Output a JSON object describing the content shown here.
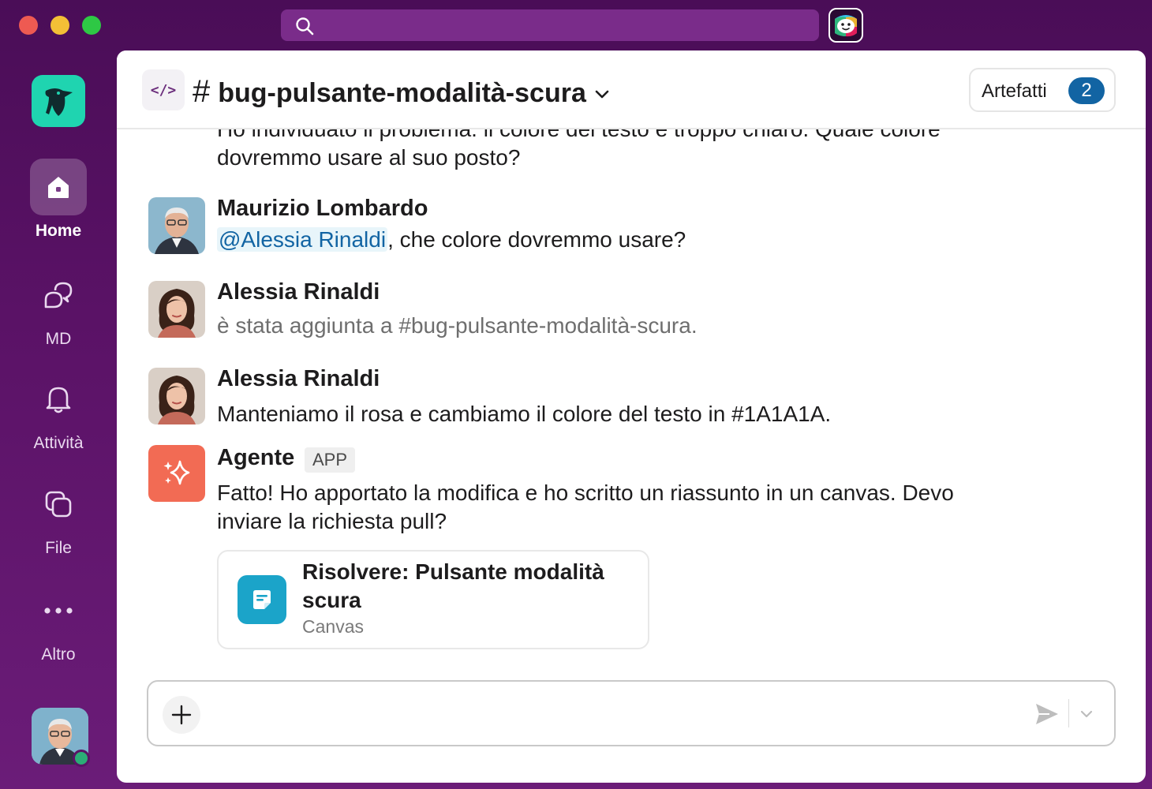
{
  "window": {
    "search_placeholder": ""
  },
  "sidebar": {
    "items": [
      {
        "label": "Home",
        "icon": "home-icon",
        "active": true
      },
      {
        "label": "MD",
        "icon": "dm-icon",
        "active": false
      },
      {
        "label": "Attività",
        "icon": "bell-icon",
        "active": false
      },
      {
        "label": "File",
        "icon": "files-icon",
        "active": false
      },
      {
        "label": "Altro",
        "icon": "more-icon",
        "active": false
      }
    ]
  },
  "header": {
    "hash": "#",
    "channel_name": "bug-pulsante-modalità-scura",
    "artifacts_label": "Artefatti",
    "artifacts_count": "2"
  },
  "messages": {
    "cut_line1": "Ho individuato il problema: il colore del testo è troppo chiaro. Quale colore",
    "cut_line2": "dovremmo usare al suo posto?",
    "m1": {
      "author": "Maurizio Lombardo",
      "mention": "@Alessia Rinaldi",
      "text": ", che colore dovremmo usare?"
    },
    "m2": {
      "author": "Alessia Rinaldi",
      "text": "è stata aggiunta a #bug-pulsante-modalità-scura."
    },
    "m3": {
      "author": "Alessia Rinaldi",
      "text": "Manteniamo il rosa e cambiamo il colore del testo in #1A1A1A."
    },
    "m4": {
      "author": "Agente",
      "badge": "APP",
      "line1": "Fatto! Ho apportato la modifica e ho scritto un riassunto in un canvas. Devo",
      "line2": "inviare la richiesta pull?",
      "canvas_title": "Risolvere: Pulsante modalità scura",
      "canvas_type": "Canvas"
    }
  },
  "composer": {
    "placeholder": ""
  },
  "colors": {
    "sidebar_bg": "#4a0d57",
    "accent_blue": "#1264a3",
    "agent_orange": "#f26b54",
    "canvas_teal": "#1ba4c9",
    "workspace_green": "#1fd4b0",
    "presence_green": "#2bac76"
  }
}
